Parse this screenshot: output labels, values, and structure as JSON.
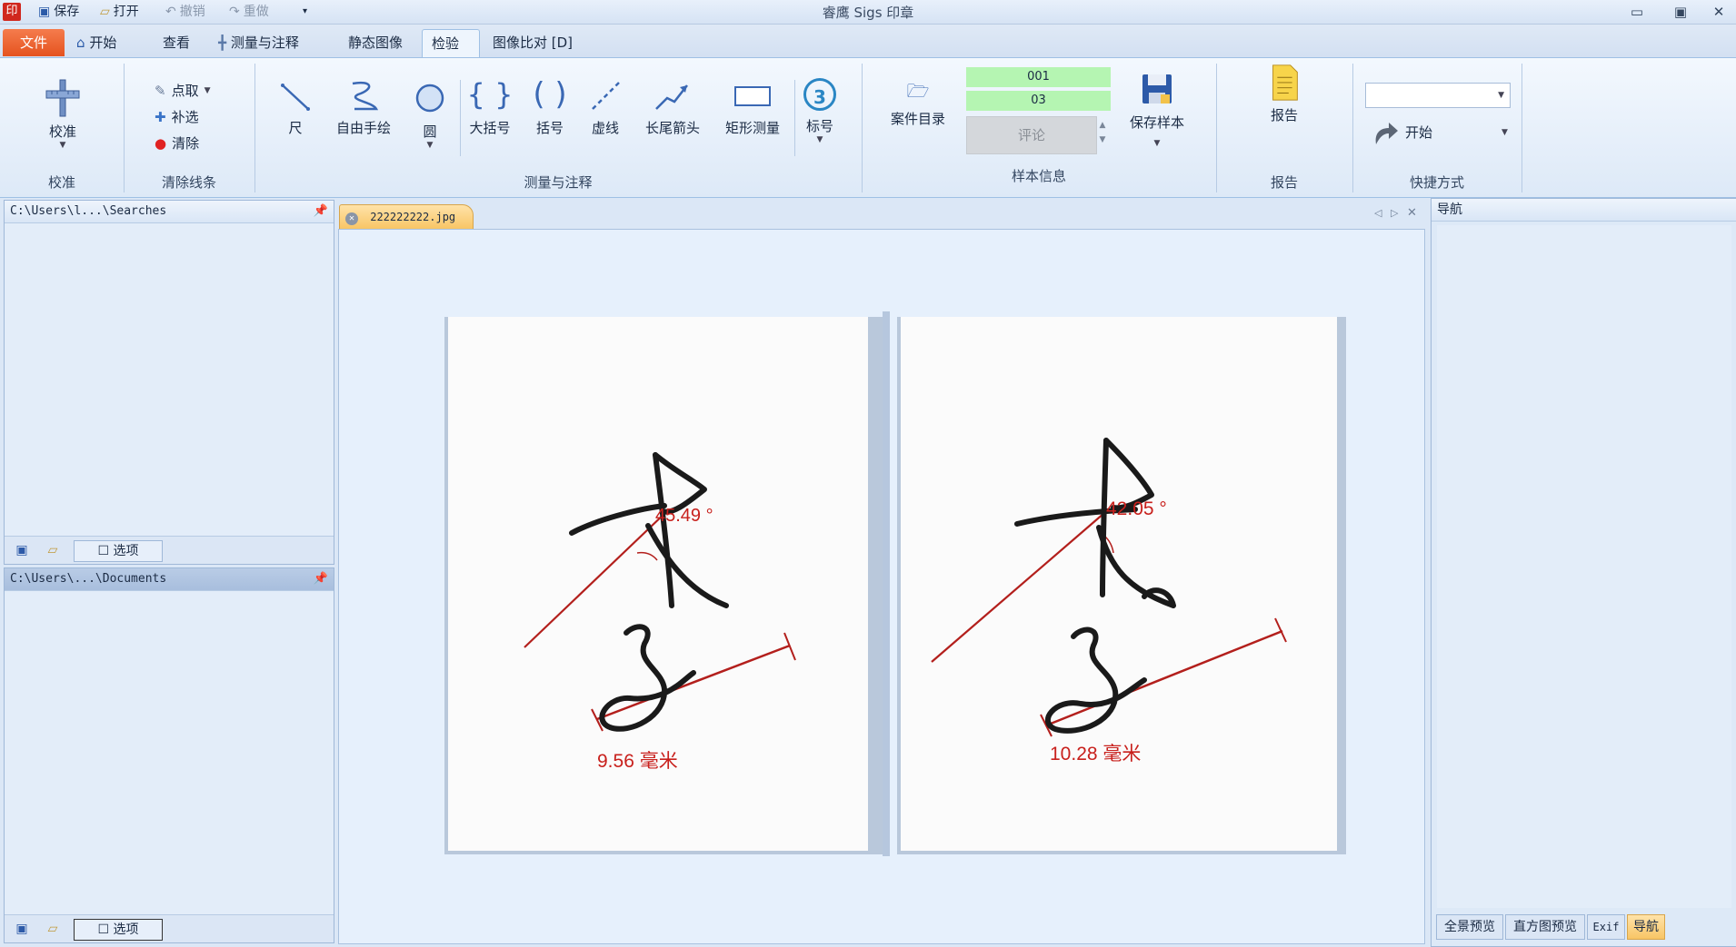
{
  "titlebar": {
    "app_icon": "印",
    "title": "睿鹰 Sigs 印章",
    "qat": [
      {
        "label": "保存",
        "icon": "save-icon"
      },
      {
        "label": "打开",
        "icon": "folder-open-icon"
      },
      {
        "label": "撤销",
        "icon": "undo-icon"
      },
      {
        "label": "重做",
        "icon": "redo-icon"
      }
    ],
    "qat_more": "▾",
    "window_buttons": [
      "▭",
      "▣",
      "✕"
    ]
  },
  "menu": {
    "file": "文件",
    "tabs": [
      "开始",
      "查看",
      "测量与注释",
      "静态图像",
      "检验",
      "图像比对 [D]"
    ],
    "active_tab": "检验"
  },
  "ribbon": {
    "calibrate": {
      "button": "校准",
      "group": "校准"
    },
    "clear_lines": {
      "items": [
        "点取",
        "补选",
        "清除"
      ],
      "group": "清除线条"
    },
    "measure": {
      "tools": [
        "尺",
        "自由手绘",
        "圆",
        "大括号",
        "括号",
        "虚线",
        "长尾箭头",
        "矩形测量",
        "标号"
      ],
      "marker_number": "3",
      "group": "测量与注释"
    },
    "sample": {
      "case_dir": "案件目录",
      "field1": "001",
      "field2": "03",
      "comment": "评论",
      "save_sample": "保存样本",
      "group": "样本信息"
    },
    "report": {
      "button": "报告",
      "group": "报告"
    },
    "shortcut": {
      "start": "开始",
      "group": "快捷方式",
      "combo_value": ""
    }
  },
  "panels": {
    "searches": {
      "path": "C:\\Users\\l...\\Searches",
      "options": "选项"
    },
    "documents": {
      "path": "C:\\Users\\...\\Documents",
      "options": "选项"
    },
    "nav": {
      "title": "导航",
      "tabs": [
        "全景预览",
        "直方图预览",
        "Exif",
        "导航"
      ],
      "active_tab": "导航"
    }
  },
  "document": {
    "tab_name": "222222222.jpg",
    "left": {
      "angle": "45.49 °",
      "length": "9.56 毫米"
    },
    "right": {
      "angle": "42.05 °",
      "length": "10.28 毫米"
    },
    "colors": {
      "annotation": "#c8201c",
      "ink": "#1a1a1a"
    }
  }
}
